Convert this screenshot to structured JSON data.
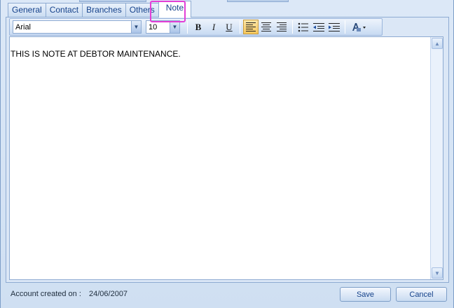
{
  "tabs": [
    {
      "label": "General"
    },
    {
      "label": "Contact"
    },
    {
      "label": "Branches"
    },
    {
      "label": "Others"
    },
    {
      "label": "Note",
      "active": true
    }
  ],
  "toolbar": {
    "font_family": "Arial",
    "font_size": "10",
    "bold": "B",
    "italic": "I",
    "underline": "U",
    "active_alignment": "left"
  },
  "icons": [
    "dropdown-arrow-icon",
    "align-left-icon",
    "align-center-icon",
    "align-right-icon",
    "bullet-list-icon",
    "decrease-indent-icon",
    "increase-indent-icon",
    "font-color-icon",
    "scroll-up-icon",
    "scroll-down-icon"
  ],
  "editor": {
    "text": "THIS IS NOTE AT DEBTOR MAINTENANCE."
  },
  "footer": {
    "created_label": "Account created on :",
    "created_date": "24/06/2007",
    "save_label": "Save",
    "cancel_label": "Cancel"
  },
  "colors": {
    "highlight": "#e33fd6",
    "accent": "#15428b"
  }
}
